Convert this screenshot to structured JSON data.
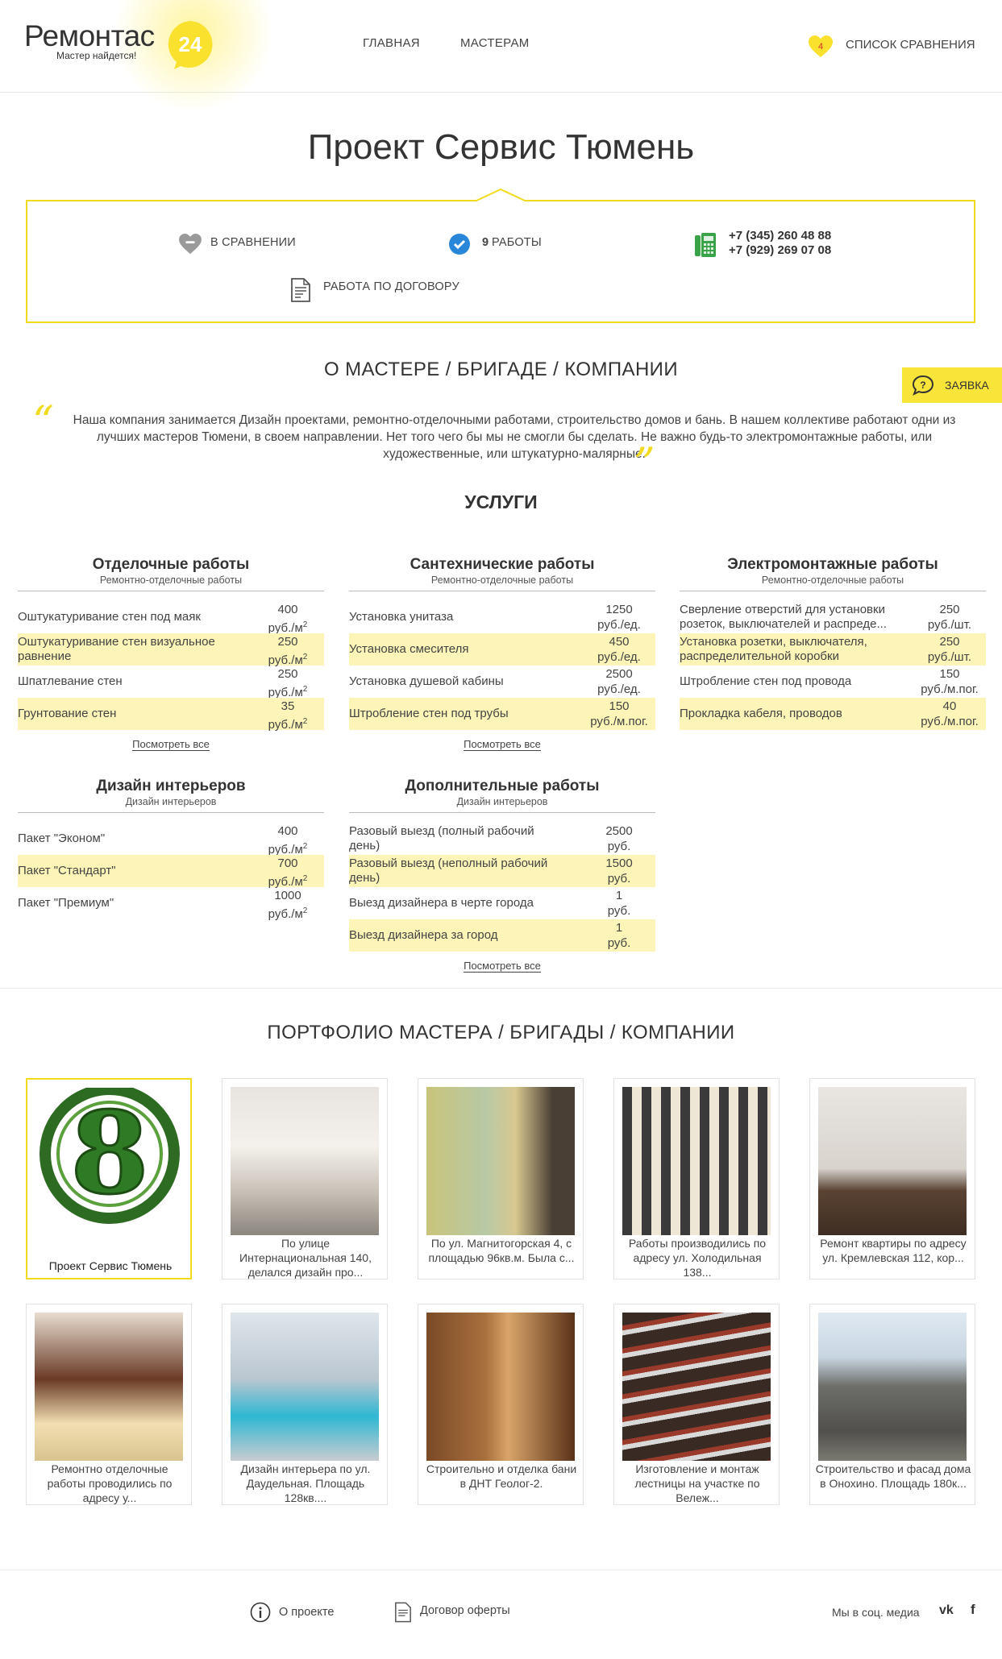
{
  "header": {
    "logo_text": "Ремонтас",
    "logo_badge": "24",
    "logo_slogan": "Мастер найдется!",
    "nav": [
      "ГЛАВНАЯ",
      "МАСТЕРАМ"
    ],
    "compare_count": "4",
    "compare_label": "СПИСОК СРАВНЕНИЯ"
  },
  "company": {
    "title": "Проект Сервис Тюмень",
    "in_compare": "В СРАВНЕНИИ",
    "works_count": "9",
    "works_label": "РАБОТЫ",
    "phone1": "+7 (345) 260 48 88",
    "phone2": "+7 (929) 269 07 08",
    "contract": "РАБОТА ПО ДОГОВОРУ"
  },
  "about": {
    "heading": "О МАСТЕРЕ / БРИГАДЕ / КОМПАНИИ",
    "text": "Наша компания занимается Дизайн проектами, ремонтно-отделочными работами, строительство домов и бань. В нашем коллективе работают одни из лучших мастеров Тюмени, в своем направлении. Нет того чего бы мы не смогли бы сделать. Не важно будь-то электромонтажные работы, или художественные, или штукатурно-малярные."
  },
  "request_button": "ЗАЯВКА",
  "services": {
    "heading": "УСЛУГИ",
    "more_label": "Посмотреть все",
    "cards": [
      {
        "title": "Отделочные работы",
        "subtitle": "Ремонтно-отделочные работы",
        "rows": [
          {
            "name": "Оштукатуривание стен под маяк",
            "price": "400",
            "unit": "руб./м",
            "sup": "2"
          },
          {
            "name": "Оштукатуривание стен визуальное\nравнение",
            "price": "250",
            "unit": "руб./м",
            "sup": "2"
          },
          {
            "name": "Шпатлевание стен",
            "price": "250",
            "unit": "руб./м",
            "sup": "2"
          },
          {
            "name": "Грунтование стен",
            "price": "35",
            "unit": "руб./м",
            "sup": "2"
          }
        ]
      },
      {
        "title": "Сантехнические работы",
        "subtitle": "Ремонтно-отделочные работы",
        "rows": [
          {
            "name": "Установка унитаза",
            "price": "1250",
            "unit": "руб./ед.",
            "sup": ""
          },
          {
            "name": "Установка смесителя",
            "price": "450",
            "unit": "руб./ед.",
            "sup": ""
          },
          {
            "name": "Установка душевой кабины",
            "price": "2500",
            "unit": "руб./ед.",
            "sup": ""
          },
          {
            "name": "Штробление стен под трубы",
            "price": "150",
            "unit": "руб./м.пог.",
            "sup": ""
          }
        ]
      },
      {
        "title": "Электромонтажные работы",
        "subtitle": "Ремонтно-отделочные работы",
        "rows": [
          {
            "name": "Сверление отверстий для установки\nрозеток, выключателей и распреде...",
            "price": "250",
            "unit": "руб./шт.",
            "sup": ""
          },
          {
            "name": "Установка розетки, выключателя,\nраспределительной коробки",
            "price": "250",
            "unit": "руб./шт.",
            "sup": ""
          },
          {
            "name": "Штробление стен под провода",
            "price": "150",
            "unit": "руб./м.пог.",
            "sup": ""
          },
          {
            "name": "Прокладка кабеля, проводов",
            "price": "40",
            "unit": "руб./м.пог.",
            "sup": ""
          }
        ]
      },
      {
        "title": "Дизайн интерьеров",
        "subtitle": "Дизайн интерьеров",
        "rows": [
          {
            "name": "Пакет \"Эконом\"",
            "price": "400",
            "unit": "руб./м",
            "sup": "2"
          },
          {
            "name": "Пакет \"Стандарт\"",
            "price": "700",
            "unit": "руб./м",
            "sup": "2"
          },
          {
            "name": "Пакет \"Премиум\"",
            "price": "1000",
            "unit": "руб./м",
            "sup": "2"
          }
        ]
      },
      {
        "title": "Дополнительные работы",
        "subtitle": "Дизайн интерьеров",
        "rows": [
          {
            "name": "Разовый выезд (полный рабочий\nдень)",
            "price": "2500",
            "unit": "руб.",
            "sup": ""
          },
          {
            "name": "Разовый выезд (неполный рабочий\nдень)",
            "price": "1500",
            "unit": "руб.",
            "sup": ""
          },
          {
            "name": "Выезд дизайнера в черте города",
            "price": "1",
            "unit": "руб.",
            "sup": ""
          },
          {
            "name": "Выезд дизайнера за город",
            "price": "1",
            "unit": "руб.",
            "sup": ""
          }
        ]
      }
    ]
  },
  "portfolio": {
    "heading": "ПОРТФОЛИО МАСТЕРА / БРИГАДЫ / КОМПАНИИ",
    "logo_digit": "8",
    "items": [
      {
        "caption": "Проект Сервис Тюмень"
      },
      {
        "caption": "По улице Интернациональная 140, делался дизайн про..."
      },
      {
        "caption": "По ул. Магнитогорская 4, с площадью 96кв.м. Была с..."
      },
      {
        "caption": "Работы производились по адресу ул. Холодильная 138..."
      },
      {
        "caption": "Ремонт квартиры по адресу ул. Кремлевская 112, кор..."
      },
      {
        "caption": "Ремонтно отделочные работы проводились по адресу у..."
      },
      {
        "caption": "Дизайн интерьера по ул. Даудельная. Площадь 128кв...."
      },
      {
        "caption": "Строительно и отделка бани в ДНТ Геолог-2."
      },
      {
        "caption": "Изготовление и монтаж лестницы на участке по Вележ..."
      },
      {
        "caption": "Строительство и фасад дома в Онохино. Площадь 180к..."
      }
    ]
  },
  "footer": {
    "about_project": "О проекте",
    "offer": "Договор оферты",
    "social_label": "Мы в соц. медиа",
    "vk": "vk",
    "fb": "f"
  },
  "colors": {
    "accent": "#f2da1e",
    "highlight": "#fcf5b7",
    "check": "#2a86d8",
    "phone": "#3aa34a"
  }
}
